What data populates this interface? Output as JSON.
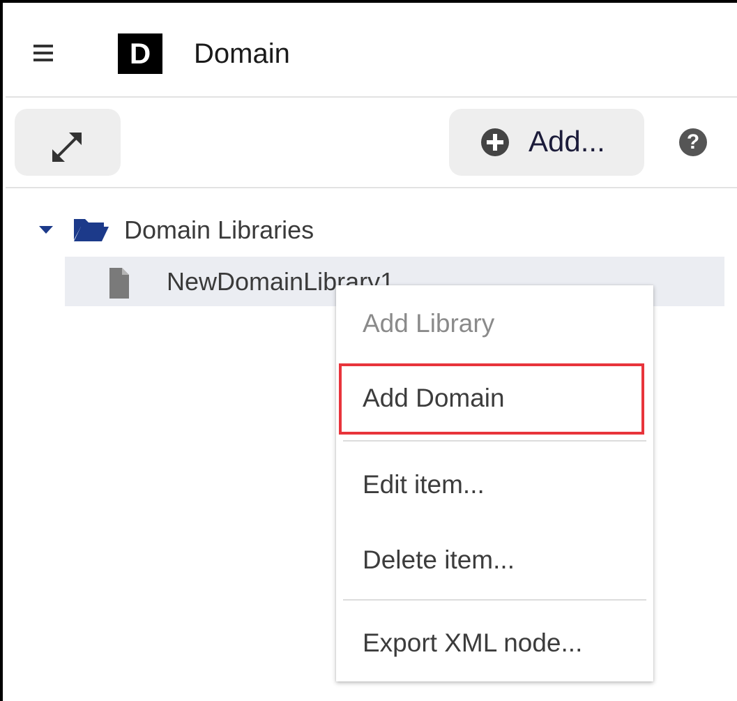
{
  "header": {
    "logo_letter": "D",
    "title": "Domain",
    "menu_icon": "hamburger-menu-icon"
  },
  "toolbar": {
    "expand_icon": "expand-arrows-icon",
    "add_label": "Add...",
    "add_icon": "plus-circle-icon",
    "help_icon": "question-mark-icon",
    "help_glyph": "?"
  },
  "tree": {
    "root": {
      "label": "Domain Libraries",
      "expanded": true,
      "icon": "open-folder-icon"
    },
    "children": [
      {
        "label": "NewDomainLibrary1",
        "icon": "document-icon",
        "selected": true
      }
    ]
  },
  "context_menu": {
    "items": [
      {
        "label": "Add Library",
        "disabled": true
      },
      {
        "label": "Add Domain",
        "disabled": false,
        "highlighted": true
      },
      {
        "label": "Edit item...",
        "disabled": false
      },
      {
        "label": "Delete item...",
        "disabled": false
      },
      {
        "label": "Export XML node...",
        "disabled": false
      }
    ]
  },
  "colors": {
    "accent_blue": "#1c3a8a",
    "highlight_red": "#e8343b",
    "selected_row": "#ebedf2",
    "button_bg": "#eeeeee"
  }
}
